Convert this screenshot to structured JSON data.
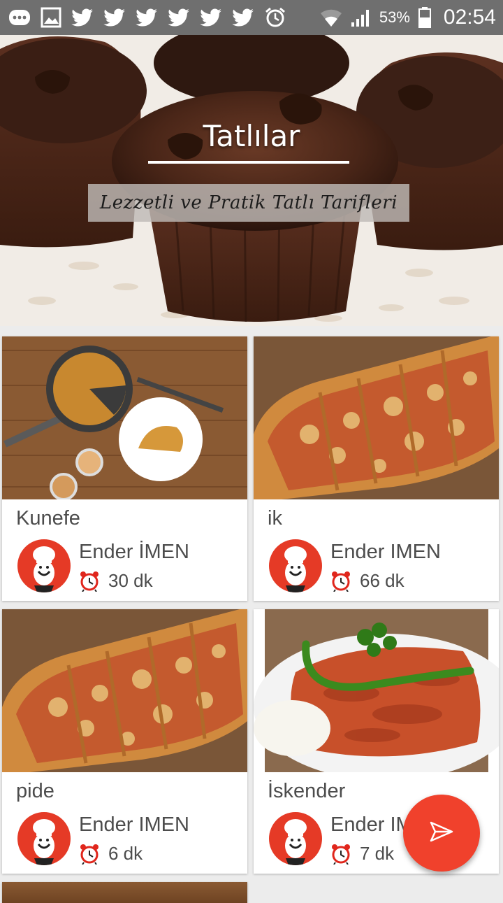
{
  "status_bar": {
    "battery": "53%",
    "time": "02:54",
    "icons": [
      "chat-icon",
      "image-icon",
      "twitter-icon",
      "twitter-icon",
      "twitter-icon",
      "twitter-icon",
      "twitter-icon",
      "twitter-icon",
      "alarm-icon",
      "wifi-icon",
      "signal-icon",
      "battery-icon"
    ]
  },
  "hero": {
    "title": "Tatlılar",
    "subtitle": "Lezzetli ve Pratik Tatlı Tarifleri"
  },
  "recipes": [
    {
      "title": "Kunefe",
      "author": "Ender İMEN",
      "duration": "30 dk",
      "image": "kunefe-photo"
    },
    {
      "title": "ik",
      "author": "Ender IMEN",
      "duration": "66 dk",
      "image": "pide-photo"
    },
    {
      "title": "pide",
      "author": "Ender IMEN",
      "duration": "6 dk",
      "image": "pide-photo"
    },
    {
      "title": "İskender",
      "author": "Ender IMEN",
      "duration": "7 dk",
      "image": "iskender-photo"
    }
  ],
  "fab": {
    "icon": "send-icon"
  },
  "colors": {
    "accent": "#f0412c",
    "avatar_bg": "#e53a26",
    "status_bar": "#6f6f6f",
    "clock_red": "#e0261c"
  }
}
